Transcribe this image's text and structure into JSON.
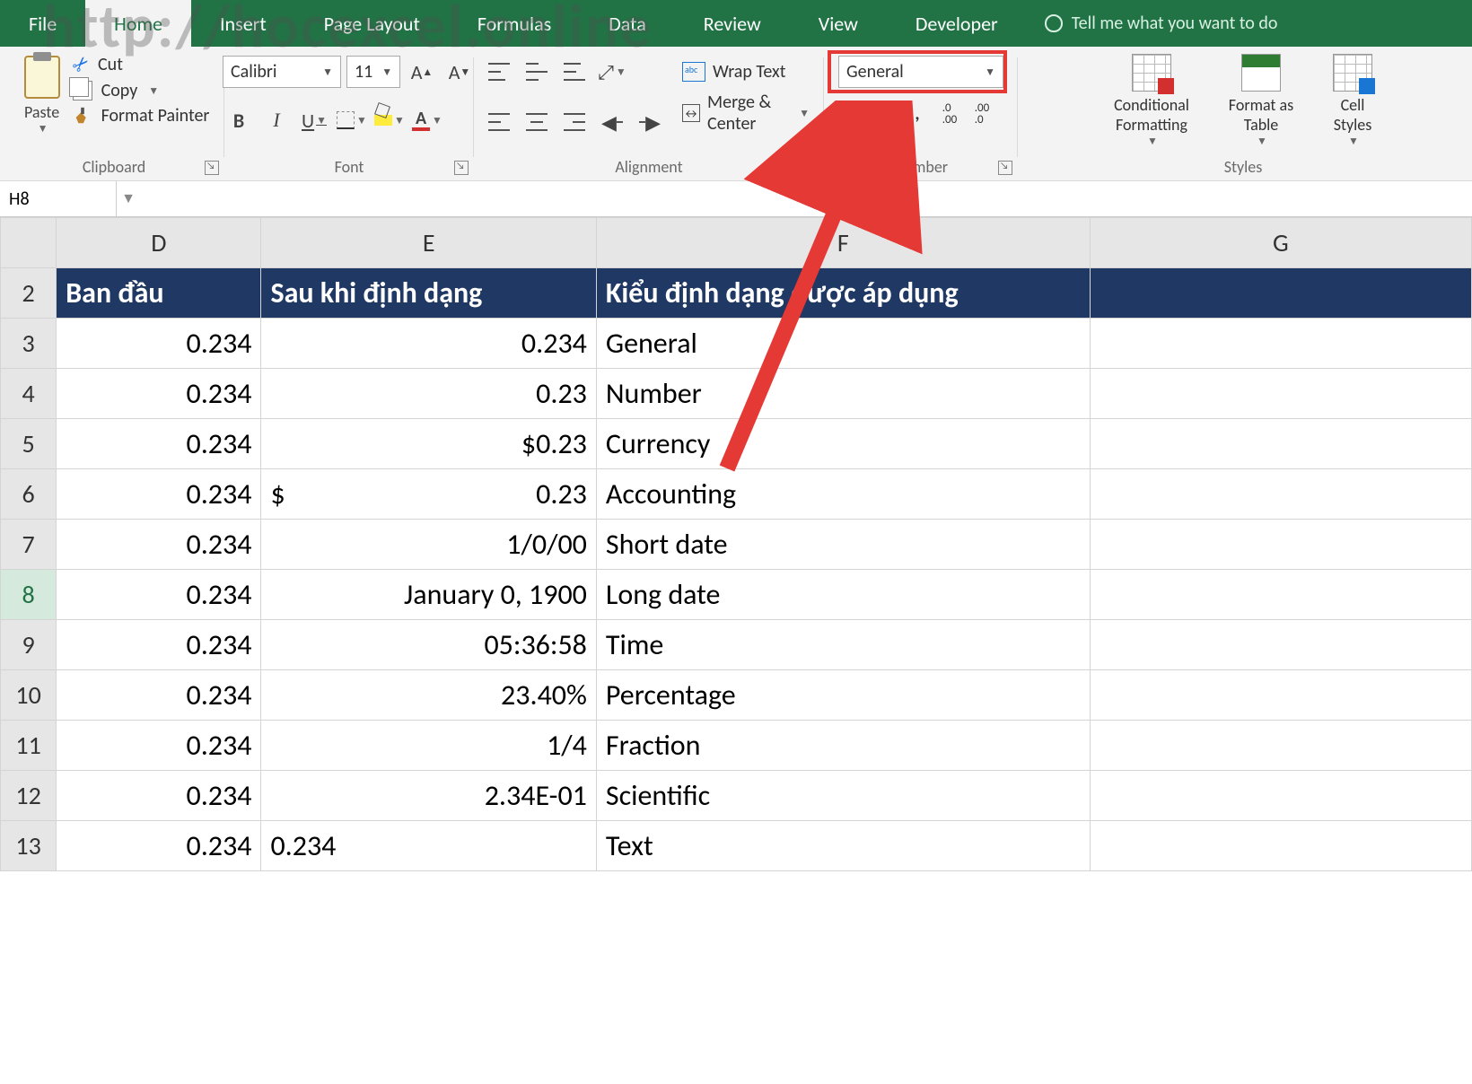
{
  "tabs": [
    "File",
    "Home",
    "Insert",
    "Page Layout",
    "Formulas",
    "Data",
    "Review",
    "View",
    "Developer"
  ],
  "active_tab": "Home",
  "tellme": "Tell me what you want to do",
  "clipboard": {
    "label": "Clipboard",
    "paste": "Paste",
    "cut": "Cut",
    "copy": "Copy",
    "painter": "Format Painter"
  },
  "font": {
    "label": "Font",
    "name": "Calibri",
    "size": "11"
  },
  "alignment": {
    "label": "Alignment",
    "wrap": "Wrap Text",
    "merge": "Merge & Center"
  },
  "number": {
    "label": "Number",
    "format": "General"
  },
  "styles": {
    "label": "Styles",
    "cond": "Conditional Formatting",
    "table": "Format as Table",
    "cell": "Cell Styles"
  },
  "namebox": "H8",
  "watermark": "http://hocexcel.online",
  "cols": [
    "D",
    "E",
    "F",
    "G"
  ],
  "header_row_num": "2",
  "headers": {
    "d": "Ban đầu",
    "e": "Sau khi định dạng",
    "f": "Kiểu định dạng được áp dụng"
  },
  "rows": [
    {
      "n": "3",
      "d": "0.234",
      "e": "0.234",
      "f": "General"
    },
    {
      "n": "4",
      "d": "0.234",
      "e": "0.23",
      "f": "Number"
    },
    {
      "n": "5",
      "d": "0.234",
      "e": "$0.23",
      "f": "Currency"
    },
    {
      "n": "6",
      "d": "0.234",
      "e_prefix": "$",
      "e": "0.23",
      "f": "Accounting",
      "acc": true
    },
    {
      "n": "7",
      "d": "0.234",
      "e": "1/0/00",
      "f": "Short date"
    },
    {
      "n": "8",
      "d": "0.234",
      "e": "January 0, 1900",
      "f": "Long date",
      "sel": true
    },
    {
      "n": "9",
      "d": "0.234",
      "e": "05:36:58",
      "f": "Time"
    },
    {
      "n": "10",
      "d": "0.234",
      "e": "23.40%",
      "f": "Percentage"
    },
    {
      "n": "11",
      "d": "0.234",
      "e": "1/4",
      "f": "Fraction"
    },
    {
      "n": "12",
      "d": "0.234",
      "e": "2.34E-01",
      "f": "Scientific"
    },
    {
      "n": "13",
      "d": "0.234",
      "e": "0.234",
      "f": "Text",
      "eleft": true
    }
  ]
}
